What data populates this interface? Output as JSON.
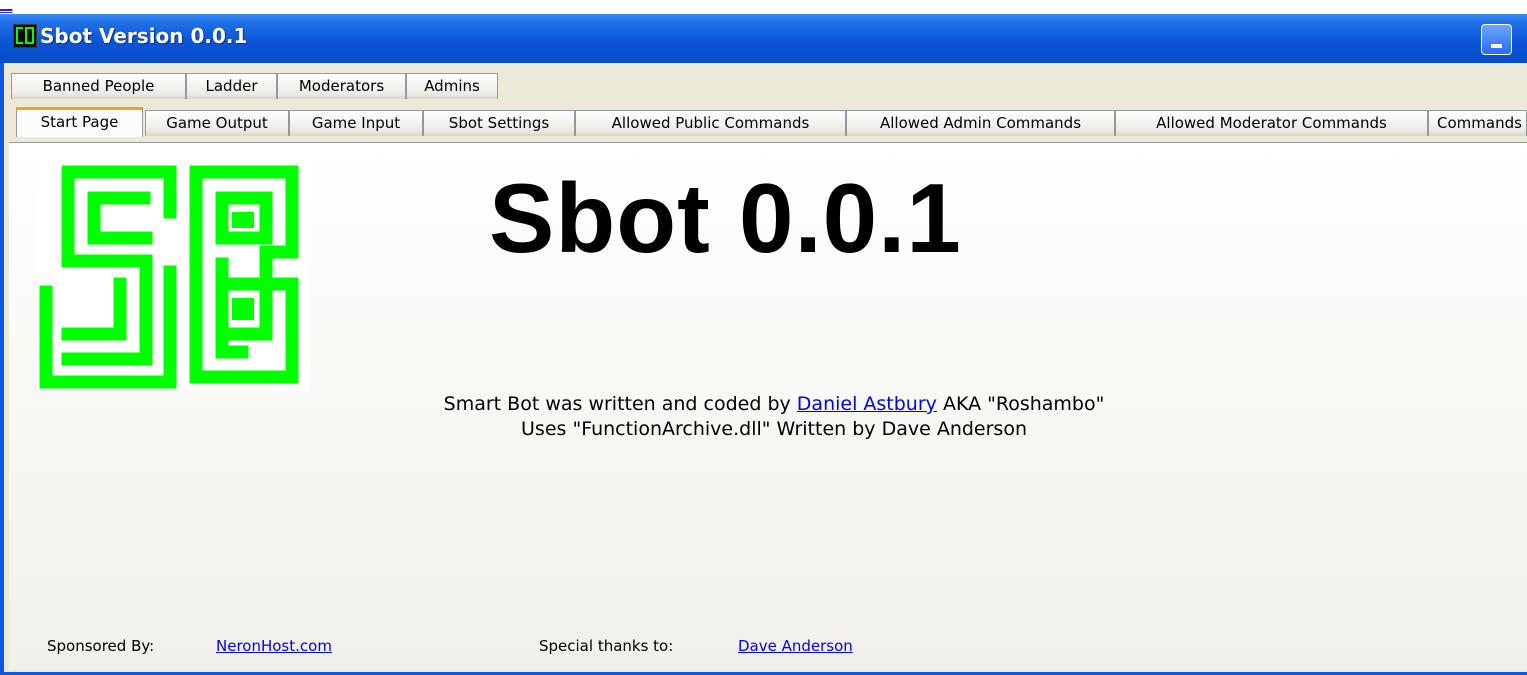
{
  "window": {
    "title": "Sbot Version 0.0.1"
  },
  "tabs_row1": [
    {
      "label": "Banned People"
    },
    {
      "label": "Ladder"
    },
    {
      "label": "Moderators"
    },
    {
      "label": "Admins"
    }
  ],
  "tabs_row2": [
    {
      "label": "Start Page",
      "selected": true
    },
    {
      "label": "Game Output"
    },
    {
      "label": "Game Input"
    },
    {
      "label": "Sbot Settings"
    },
    {
      "label": "Allowed Public Commands"
    },
    {
      "label": "Allowed Admin Commands"
    },
    {
      "label": "Allowed Moderator Commands"
    },
    {
      "label": "Commands"
    }
  ],
  "start_page": {
    "logo": {
      "text": "SB",
      "color": "#00ff00"
    },
    "heading": "Sbot 0.0.1",
    "credit_line1_prefix": "Smart Bot was written and coded by",
    "credit_author_link": "Daniel Astbury",
    "credit_line1_suffix": "AKA \"Roshambo\"",
    "credit_line2": "Uses \"FunctionArchive.dll\" Written by Dave Anderson",
    "sponsored_label": "Sponsored By:",
    "sponsor_link": "NeronHost.com",
    "thanks_label": "Special thanks to:",
    "thanks_link": "Dave Anderson"
  },
  "colors": {
    "titlebar": "#0b55d6",
    "link": "#0000ff",
    "active_tab_accent": "#f7a21b",
    "logo_green": "#00ff00"
  }
}
